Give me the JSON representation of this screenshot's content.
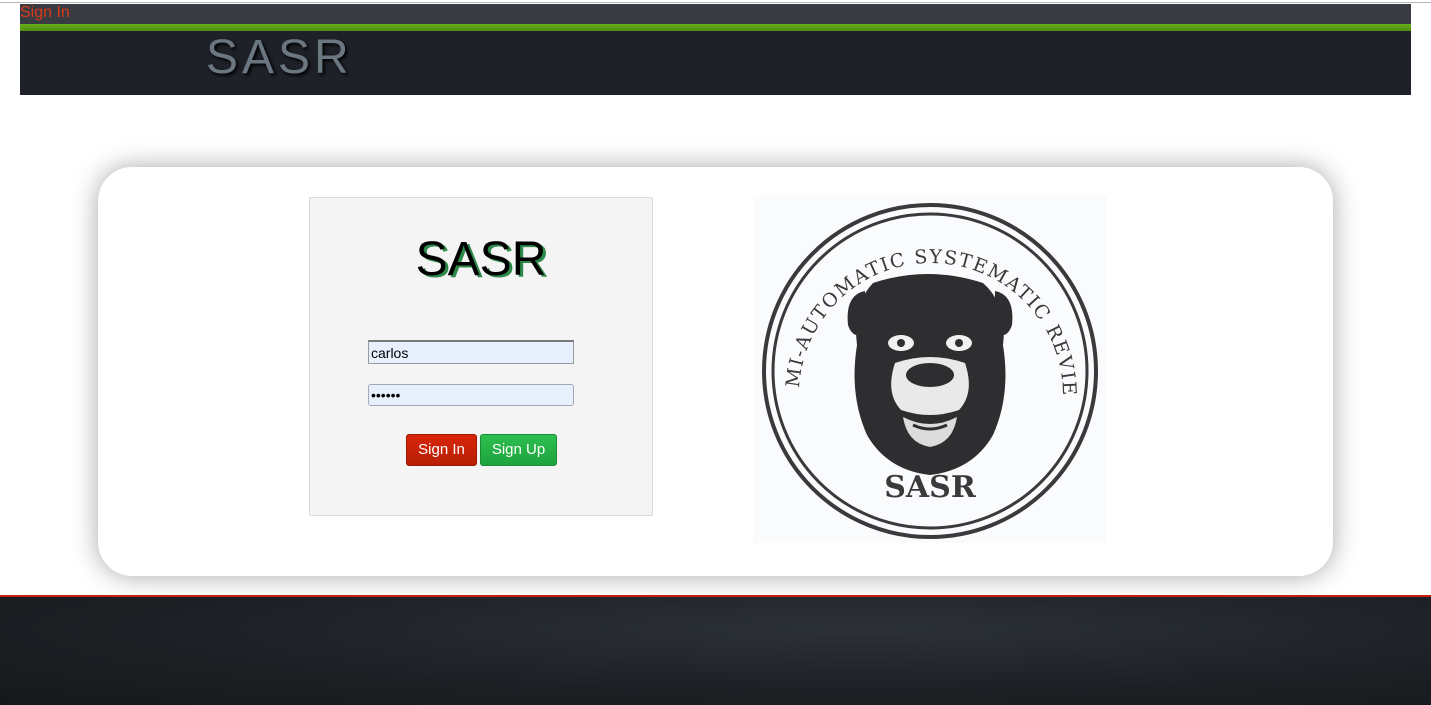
{
  "top_link": {
    "label": "Sign In"
  },
  "header": {
    "brand": "SASR"
  },
  "login": {
    "logo_text": "SASR",
    "username_value": "carlos",
    "password_value": "••••••",
    "signin_label": "Sign In",
    "signup_label": "Sign Up"
  },
  "emblem": {
    "arc_text": "SEMI-AUTOMATIC SYSTEMATIC REVIEW",
    "title": "SASR"
  },
  "colors": {
    "header_bg": "#1e2128",
    "accent_green": "#5a9e13",
    "signin_red": "#c8230a",
    "signup_green": "#25b347",
    "footer_rule": "#c81e10"
  }
}
